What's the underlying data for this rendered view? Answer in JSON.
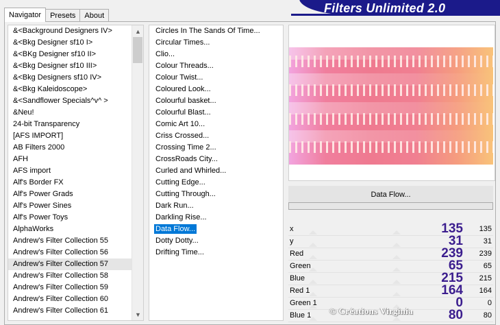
{
  "tabs": [
    "Navigator",
    "Presets",
    "About"
  ],
  "banner_title": "Filters Unlimited 2.0",
  "categories": [
    "&<Background Designers IV>",
    "&<Bkg Designer sf10 I>",
    "&<BKg Designer sf10 II>",
    "&<Bkg Designer sf10 III>",
    "&<Bkg Designers sf10 IV>",
    "&<Bkg Kaleidoscope>",
    "&<Sandflower Specials^v^ >",
    "&Neu!",
    "24-bit Transparency",
    "[AFS IMPORT]",
    "AB Filters 2000",
    "AFH",
    "AFS import",
    "Alf's Border FX",
    "Alf's Power Grads",
    "Alf's Power Sines",
    "Alf's Power Toys",
    "AlphaWorks",
    "Andrew's Filter Collection 55",
    "Andrew's Filter Collection 56",
    "Andrew's Filter Collection 57",
    "Andrew's Filter Collection 58",
    "Andrew's Filter Collection 59",
    "Andrew's Filter Collection 60",
    "Andrew's Filter Collection 61"
  ],
  "selected_category": "Andrew's Filter Collection 57",
  "filters": [
    "Circles In The Sands Of Time...",
    "Circular Times...",
    "Clio...",
    "Colour Threads...",
    "Colour Twist...",
    "Coloured Look...",
    "Colourful basket...",
    "Colourful Blast...",
    "Comic Art 10...",
    "Criss Crossed...",
    "Crossing Time 2...",
    "CrossRoads City...",
    "Curled and Whirled...",
    "Cutting Edge...",
    "Cutting Through...",
    "Dark Run...",
    "Darkling Rise...",
    "Data Flow...",
    "Dotty Dotty...",
    "Drifting Time..."
  ],
  "selected_filter": "Data Flow...",
  "current_filter_name": "Data Flow...",
  "progress_value": 0,
  "parameters": [
    {
      "name": "x",
      "big": "135",
      "value": "135"
    },
    {
      "name": "y",
      "big": "31",
      "value": "31"
    },
    {
      "name": "Red",
      "big": "239",
      "value": "239"
    },
    {
      "name": "Green",
      "big": "65",
      "value": "65"
    },
    {
      "name": "Blue",
      "big": "215",
      "value": "215"
    },
    {
      "name": "Red 1",
      "big": "164",
      "value": "164"
    },
    {
      "name": "Green 1",
      "big": "0",
      "value": "0"
    },
    {
      "name": "Blue 1",
      "big": "80",
      "value": "80"
    }
  ],
  "watermark": "© Créations Virginia",
  "colors": {
    "banner": "#1b1a8a",
    "selection": "#0078d7",
    "param_big_text": "#3b1d8e"
  }
}
